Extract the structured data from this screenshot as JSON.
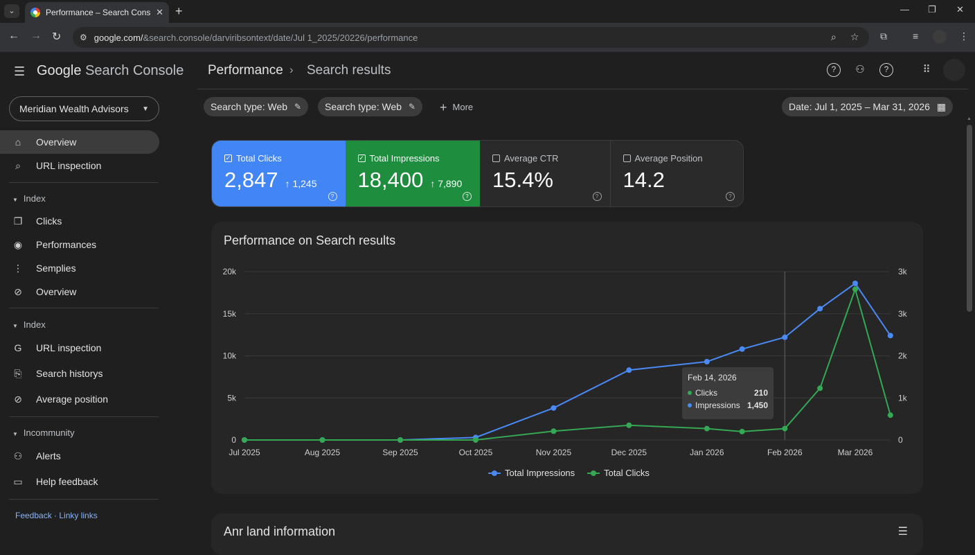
{
  "browser": {
    "tab_title": "Performance – Search Console",
    "url_host": "google.com/",
    "url_path": "&search.console/darviribsontext/date/Jul 1_2025/20226/performance"
  },
  "app": {
    "logo_google": "Google",
    "logo_product": "Search Console",
    "breadcrumb": [
      "Performance",
      "Search results"
    ]
  },
  "sidebar": {
    "property": "Meridian Wealth Advisors",
    "top_items": [
      {
        "label": "Overview",
        "icon": "home-icon",
        "active": true
      },
      {
        "label": "URL inspection",
        "icon": "search-icon",
        "active": false
      }
    ],
    "sections": [
      {
        "title": "Index",
        "items": [
          {
            "label": "Clicks",
            "icon": "pages-icon"
          },
          {
            "label": "Performances",
            "icon": "eye-icon"
          },
          {
            "label": "Semplies",
            "icon": "sitemap-icon"
          },
          {
            "label": "Overview",
            "icon": "eye-off-icon"
          }
        ]
      },
      {
        "title": "Index",
        "items": [
          {
            "label": "URL inspection",
            "icon": "google-g-icon"
          },
          {
            "label": "Search historys",
            "icon": "removals-icon"
          },
          {
            "label": "Average position",
            "icon": "crossed-circle-icon"
          }
        ]
      },
      {
        "title": "Incommunity",
        "items": [
          {
            "label": "Alerts",
            "icon": "people-icon"
          },
          {
            "label": "Help feedback",
            "icon": "feedback-icon"
          }
        ]
      }
    ],
    "footer": "Feedback · Linky links"
  },
  "filters": {
    "chip1": "Search type: Web",
    "chip2": "Search type: Web",
    "more": "More",
    "date": "Date: Jul 1, 2025 – Mar 31, 2026"
  },
  "metrics": [
    {
      "label": "Total Clicks",
      "value": "2,847",
      "delta": "1,245",
      "checked": true,
      "color": "#4285f4"
    },
    {
      "label": "Total Impressions",
      "value": "18,400",
      "delta": "7,890",
      "checked": true,
      "color": "#1e8e3e"
    },
    {
      "label": "Average CTR",
      "value": "15.4%",
      "delta": "",
      "checked": false
    },
    {
      "label": "Average Position",
      "value": "14.2",
      "delta": "",
      "checked": false
    }
  ],
  "chart": {
    "title": "Performance on Search results",
    "tooltip": {
      "date": "Feb 14, 2026",
      "clicks_label": "Clicks",
      "clicks": "210",
      "impr_label": "Impressions",
      "impr": "1,450"
    }
  },
  "panel2": {
    "title": "Anr land information"
  },
  "chart_data": {
    "type": "line",
    "title": "Performance on Search results",
    "x": [
      "Jul 2025",
      "Aug 2025",
      "Sep 2025",
      "Oct 2025",
      "Nov 2025",
      "Dec 2025",
      "Jan 2026",
      "Feb 2026",
      "Mar 2026"
    ],
    "y_left_ticks": [
      "0",
      "5k",
      "10k",
      "15k",
      "20k"
    ],
    "y_right_ticks": [
      "0",
      "1k",
      "2k",
      "3k",
      "3k"
    ],
    "ylim_left": [
      0,
      20000
    ],
    "ylim_right": [
      0,
      4000
    ],
    "series": [
      {
        "name": "Total Impressions",
        "color": "#4a8af4",
        "axis": "left",
        "points": [
          [
            "2025-07-01",
            0
          ],
          [
            "2025-08-01",
            0
          ],
          [
            "2025-09-01",
            0
          ],
          [
            "2025-10-01",
            300
          ],
          [
            "2025-11-01",
            3800
          ],
          [
            "2025-12-01",
            8300
          ],
          [
            "2026-01-01",
            9300
          ],
          [
            "2026-01-15",
            10800
          ],
          [
            "2026-02-01",
            12200
          ],
          [
            "2026-02-15",
            15600
          ],
          [
            "2026-03-01",
            18600
          ],
          [
            "2026-03-15",
            12400
          ]
        ]
      },
      {
        "name": "Total Clicks",
        "color": "#34a853",
        "axis": "right",
        "points": [
          [
            "2025-07-01",
            0
          ],
          [
            "2025-08-01",
            0
          ],
          [
            "2025-09-01",
            0
          ],
          [
            "2025-10-01",
            0
          ],
          [
            "2025-11-01",
            210
          ],
          [
            "2025-12-01",
            350
          ],
          [
            "2026-01-01",
            270
          ],
          [
            "2026-01-15",
            200
          ],
          [
            "2026-02-01",
            270
          ],
          [
            "2026-02-15",
            1230
          ],
          [
            "2026-03-01",
            3580
          ],
          [
            "2026-03-15",
            590
          ]
        ]
      }
    ],
    "legend": "bottom-center",
    "grid": true
  }
}
